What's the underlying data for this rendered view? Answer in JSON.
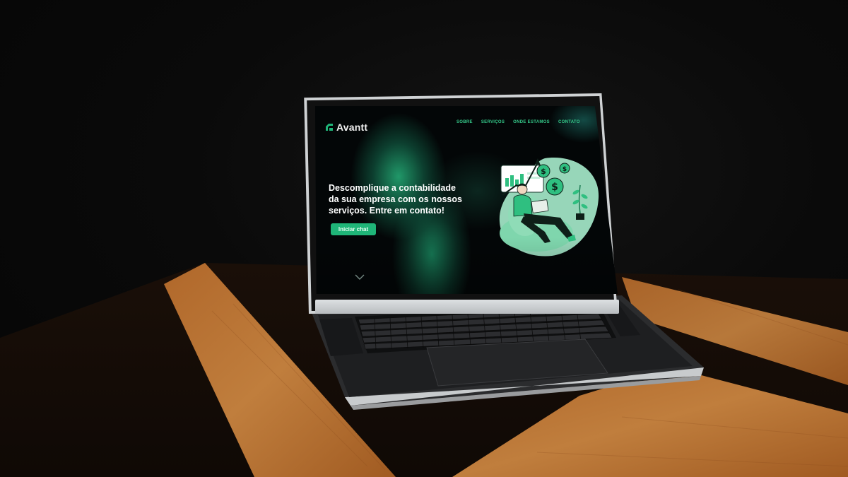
{
  "site": {
    "brand": "Avantt",
    "nav": [
      "SOBRE",
      "SERVIÇOS",
      "ONDE ESTAMOS",
      "CONTATO"
    ],
    "hero": {
      "headline_lines": [
        "Descomplique a contabilidade",
        "da sua empresa com os nossos",
        "serviços. Entre em contato!"
      ],
      "cta_label": "Iniciar chat"
    }
  },
  "icons": {
    "brand": "avantt-logo-icon",
    "scroll": "chevron-down-icon",
    "illustration": "finance-illustration"
  },
  "colors": {
    "accent": "#1fb578",
    "nav": "#35c98a",
    "screen_bg": "#030607",
    "illustration_mint": "#9fe2c3"
  }
}
